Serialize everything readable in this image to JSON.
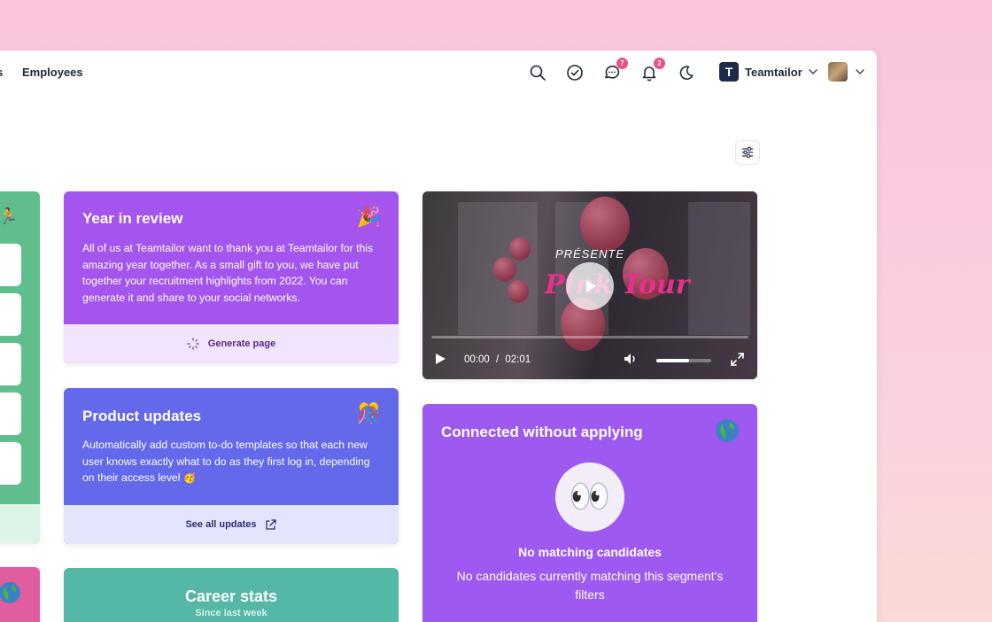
{
  "nav": {
    "fragment": "s",
    "employees": "Employees",
    "messages_badge": "7",
    "notifications_badge": "2",
    "company_initial": "T",
    "company_name": "Teamtailor"
  },
  "year_in_review": {
    "title": "Year in review",
    "body": "All of us at Teamtailor want to thank you at Teamtailor for this amazing year together. As a small gift to you, we have put together your recruitment highlights from 2022. You can generate it and share to your social networks.",
    "action": "Generate page",
    "emoji": "🎉"
  },
  "product_updates": {
    "title": "Product updates",
    "body": "Automatically add custom to-do templates so that each new user knows exactly what to do as they first log in, depending on their access level 🥳",
    "action": "See all updates",
    "emoji": "🎊"
  },
  "career_stats": {
    "title": "Career stats",
    "subtitle": "Since last week"
  },
  "video": {
    "overlay_text": "PRÉSENTE",
    "brand_text": "Pink Tour",
    "current_time": "00:00",
    "separator": "/",
    "duration": "02:01",
    "volume_level": 0.6
  },
  "connected": {
    "title": "Connected without applying",
    "eyes": "👀",
    "empty_title": "No matching candidates",
    "empty_body": "No candidates currently matching this segment's filters"
  },
  "side_card": {
    "emoji": "🏃"
  },
  "colors": {
    "year_in_review": "#a455ee",
    "product_updates": "#6468ea",
    "career_stats": "#55b7a5",
    "connected": "#9e59f0",
    "badge": "#e8508a"
  }
}
